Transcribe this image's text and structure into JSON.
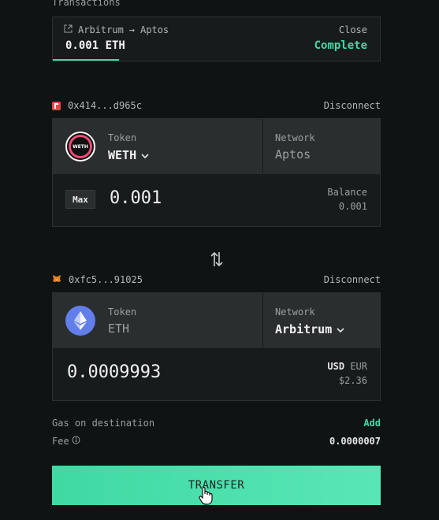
{
  "transactions": {
    "title": "Transactions",
    "route_from": "Arbitrum",
    "route_arrow": "→",
    "route_to": "Aptos",
    "amount": "0.001 ETH",
    "close_label": "Close",
    "status": "Complete"
  },
  "source": {
    "wallet_address": "0x414...d965c",
    "disconnect_label": "Disconnect",
    "token_label": "Token",
    "token_value": "WETH",
    "token_logo_text": "WETH",
    "network_label": "Network",
    "network_value": "Aptos",
    "max_label": "Max",
    "amount": "0.001",
    "balance_label": "Balance",
    "balance_value": "0.001"
  },
  "destination": {
    "wallet_address": "0xfc5...91025",
    "disconnect_label": "Disconnect",
    "token_label": "Token",
    "token_value": "ETH",
    "network_label": "Network",
    "network_value": "Arbitrum",
    "amount": "0.0009993",
    "currency_usd": "USD",
    "currency_eur": "EUR",
    "fiat_value": "$2.36"
  },
  "fees": {
    "gas_label": "Gas on destination",
    "gas_action": "Add",
    "fee_label": "Fee",
    "fee_value": "0.0000007"
  },
  "transfer_label": "TRANSFER",
  "colors": {
    "accent": "#3ddba6",
    "background": "#0f1313",
    "panel": "#171b1b",
    "cell": "#2a2e2e"
  }
}
